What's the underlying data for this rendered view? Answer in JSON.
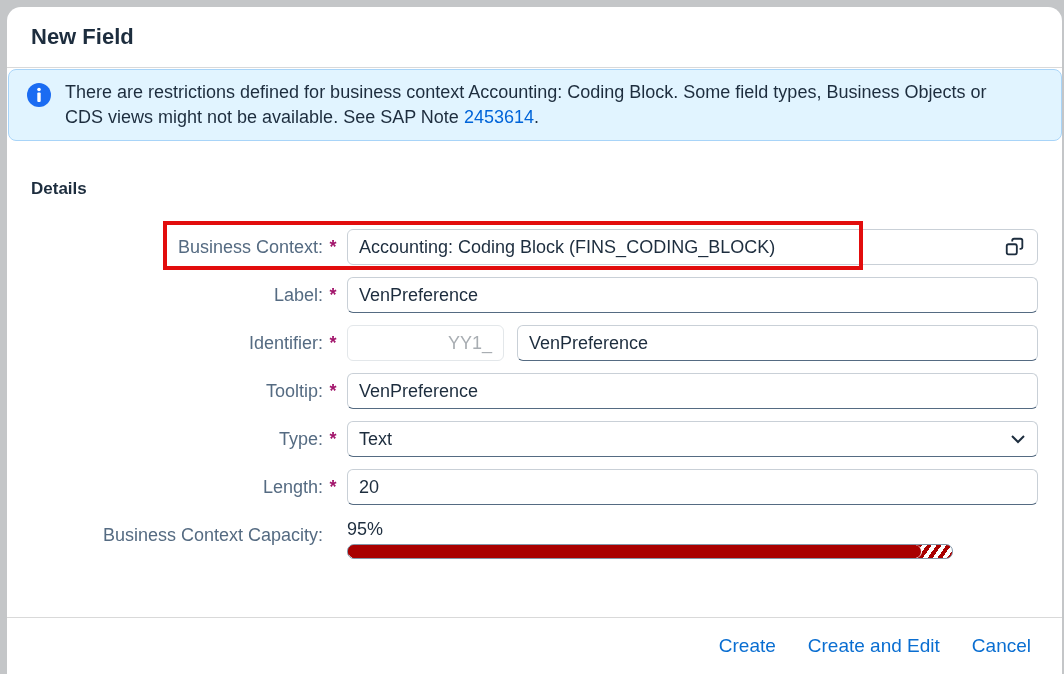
{
  "dialog": {
    "title": "New Field"
  },
  "message": {
    "kind": "information",
    "text": "There are restrictions defined for business context Accounting: Coding Block. Some field types, Business Objects or CDS views might not be available. See SAP Note ",
    "link": "2453614",
    "suffix": "."
  },
  "section_title": "Details",
  "fields": [
    {
      "kind": "value_help",
      "label": "Business Context:",
      "required_mark": "*",
      "value": "Accounting: Coding Block (FINS_CODING_BLOCK)",
      "highlighted": true
    },
    {
      "kind": "text",
      "label": "Label:",
      "required_mark": "*",
      "value": "VenPreference",
      "highlighted": false
    },
    {
      "kind": "prefixed",
      "label": "Identifier:",
      "required_mark": "*",
      "prefix": "YY1_",
      "value": "VenPreference",
      "highlighted": false
    },
    {
      "kind": "text",
      "label": "Tooltip:",
      "required_mark": "*",
      "value": "VenPreference",
      "highlighted": false
    },
    {
      "kind": "select",
      "label": "Type:",
      "required_mark": "*",
      "value": "Text",
      "highlighted": false
    },
    {
      "kind": "text",
      "label": "Length:",
      "required_mark": "*",
      "value": "20",
      "highlighted": false
    }
  ],
  "capacity": {
    "label": "Business Context Capacity:",
    "reading": "95%",
    "level": 0.95
  },
  "buttons": [
    {
      "label": "Create"
    },
    {
      "label": "Create and Edit"
    },
    {
      "label": "Cancel"
    }
  ]
}
